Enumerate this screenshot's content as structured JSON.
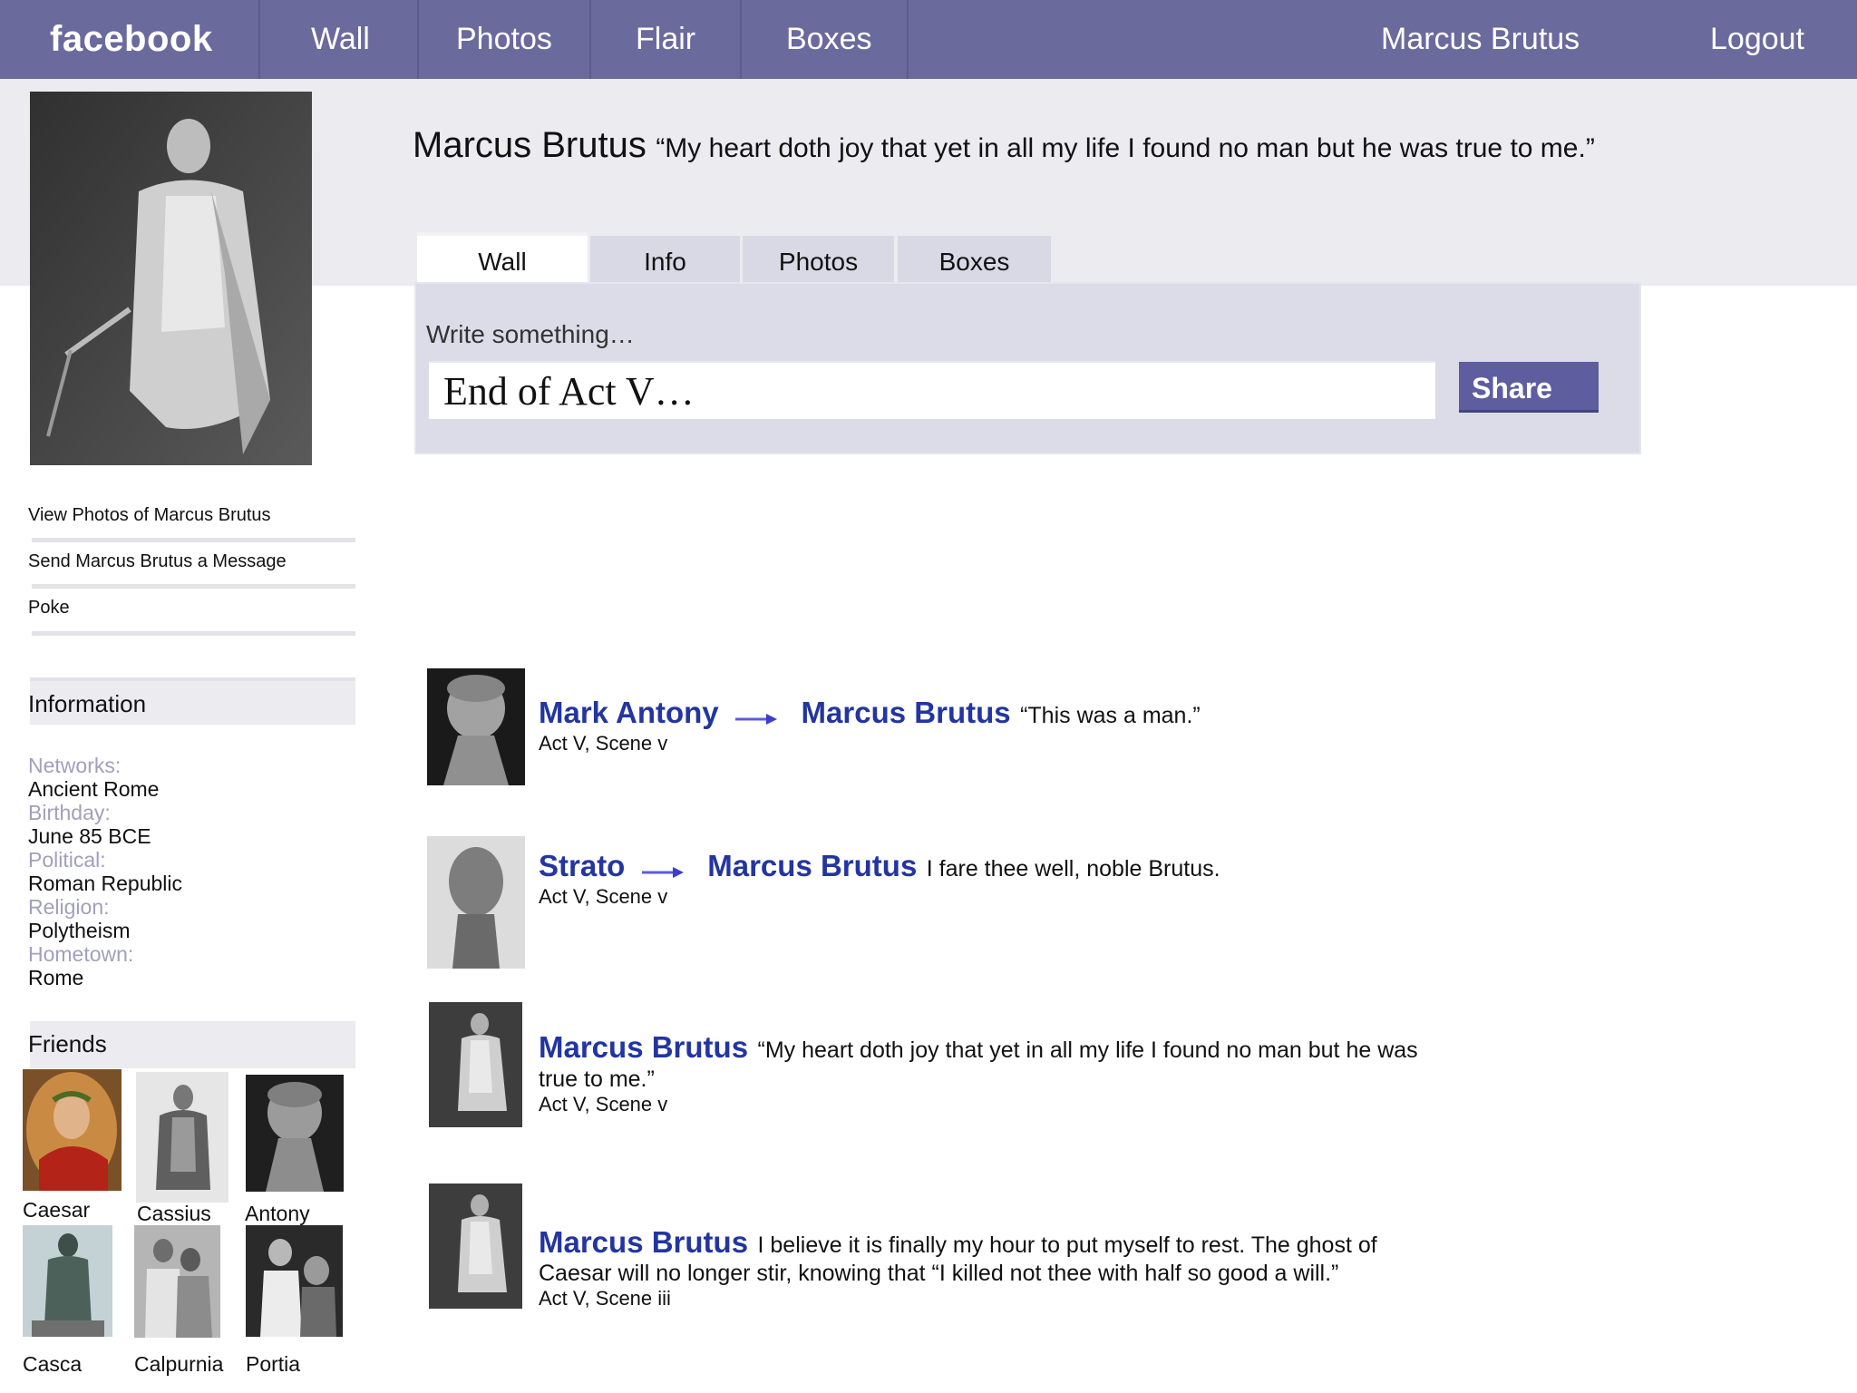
{
  "topbar": {
    "brand": "facebook",
    "nav": [
      "Wall",
      "Photos",
      "Flair",
      "Boxes"
    ],
    "user": "Marcus Brutus",
    "logout": "Logout"
  },
  "profile": {
    "name": "Marcus Brutus",
    "quote": "“My heart doth joy that yet in all my life I found no man but he was true to me.”"
  },
  "tabs": [
    "Wall",
    "Info",
    "Photos",
    "Boxes"
  ],
  "composer": {
    "label": "Write something…",
    "value": "End of Act V…",
    "share_label": "Share"
  },
  "sidebar": {
    "links": [
      "View Photos of Marcus Brutus",
      "Send Marcus Brutus a Message",
      "Poke"
    ],
    "information": {
      "header": "Information",
      "fields": [
        {
          "label": "Networks:",
          "value": "Ancient Rome"
        },
        {
          "label": "Birthday:",
          "value": "June 85 BCE"
        },
        {
          "label": "Political:",
          "value": "Roman Republic"
        },
        {
          "label": "Religion:",
          "value": "Polytheism"
        },
        {
          "label": "Hometown:",
          "value": "Rome"
        }
      ]
    },
    "friends": {
      "header": "Friends",
      "names": [
        "Caesar",
        "Cassius",
        "Antony",
        "Casca",
        "Calpurnia",
        "Portia"
      ]
    }
  },
  "posts": [
    {
      "author": "Mark Antony",
      "target": "Marcus Brutus",
      "text": "“This was a man.”",
      "meta": "Act V, Scene v"
    },
    {
      "author": "Strato",
      "target": "Marcus Brutus",
      "text": "I fare thee well, noble Brutus.",
      "meta": "Act V, Scene v"
    },
    {
      "author": "Marcus Brutus",
      "text": "“My heart doth joy that yet in all my life I found no man but he was",
      "text2": "true to me.”",
      "meta": "Act V, Scene v"
    },
    {
      "author": "Marcus Brutus",
      "text": "I believe it is finally my hour to put myself to rest. The ghost of",
      "text2": "Caesar will no longer stir, knowing that “I killed not thee with half so good a will.”",
      "meta": "Act V, Scene iii"
    }
  ],
  "colors": {
    "topbar": "#6b6a9d",
    "author_link": "#2335a0",
    "share_button": "#5d5da0",
    "info_label": "#a0a0bd"
  }
}
